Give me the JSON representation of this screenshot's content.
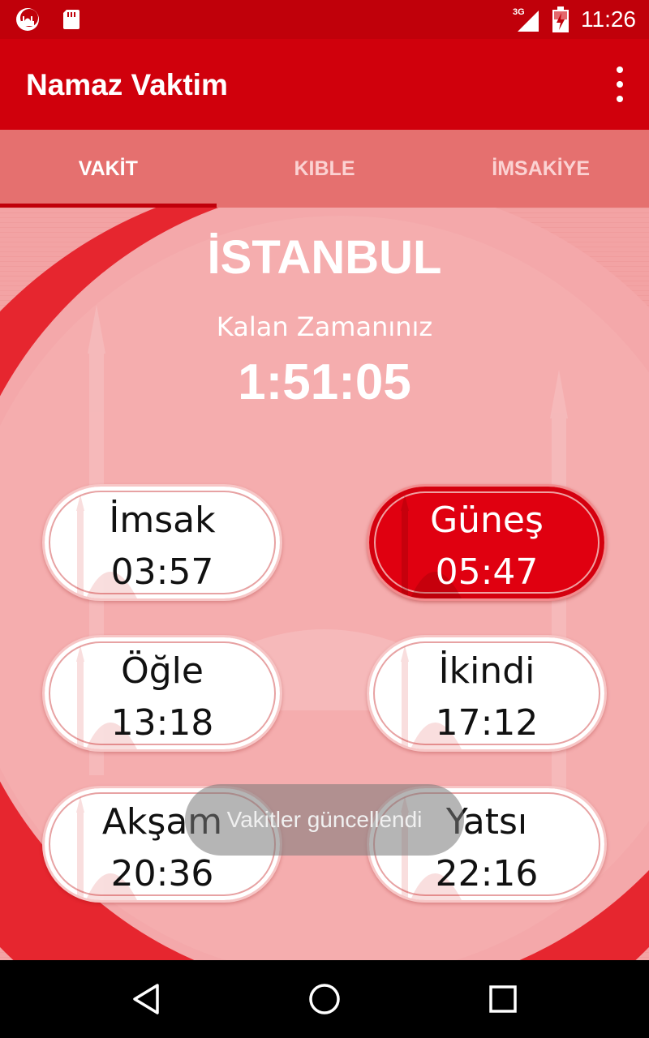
{
  "status_bar": {
    "time": "11:26",
    "network_label": "3G",
    "icons": [
      "app-notification-icon",
      "sd-card-icon",
      "signal-icon",
      "battery-charging-icon"
    ]
  },
  "app_bar": {
    "title": "Namaz Vaktim",
    "overflow_icon": "more-vert-icon"
  },
  "tabs": [
    {
      "label": "VAKİT",
      "active": true
    },
    {
      "label": "KIBLE",
      "active": false
    },
    {
      "label": "İMSAKİYE",
      "active": false
    }
  ],
  "main": {
    "city": "İSTANBUL",
    "remaining_label": "Kalan Zamanınız",
    "countdown": "1:51:05"
  },
  "prayer_times": [
    {
      "name": "İmsak",
      "time": "03:57",
      "highlighted": false
    },
    {
      "name": "Güneş",
      "time": "05:47",
      "highlighted": true
    },
    {
      "name": "Öğle",
      "time": "13:18",
      "highlighted": false
    },
    {
      "name": "İkindi",
      "time": "17:12",
      "highlighted": false
    },
    {
      "name": "Akşam",
      "time": "20:36",
      "highlighted": false
    },
    {
      "name": "Yatsı",
      "time": "22:16",
      "highlighted": false
    }
  ],
  "toast": {
    "message": "Vakitler güncellendi"
  },
  "nav_bar": {
    "icons": [
      "back-icon",
      "home-icon",
      "recents-icon"
    ]
  },
  "colors": {
    "status_bar": "#c0000a",
    "app_bar": "#d0000c",
    "tab_bar": "#e5706f",
    "content_bg": "#f3a3a4",
    "highlight": "#e00010"
  }
}
